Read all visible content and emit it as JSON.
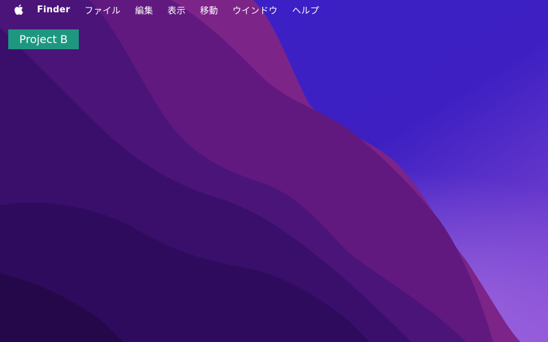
{
  "menubar": {
    "apple_icon": "apple-logo-icon",
    "app_name": "Finder",
    "items": [
      {
        "label": "ファイル"
      },
      {
        "label": "編集"
      },
      {
        "label": "表示"
      },
      {
        "label": "移動"
      },
      {
        "label": "ウインドウ"
      },
      {
        "label": "ヘルプ"
      }
    ]
  },
  "desktop": {
    "selected_item_label": "Project B",
    "label_color": "#1e9781"
  },
  "colors": {
    "wallpaper_base": "#3a148a",
    "wallpaper_light": "#6a3be0",
    "wallpaper_magenta": "#7a2a8f"
  }
}
